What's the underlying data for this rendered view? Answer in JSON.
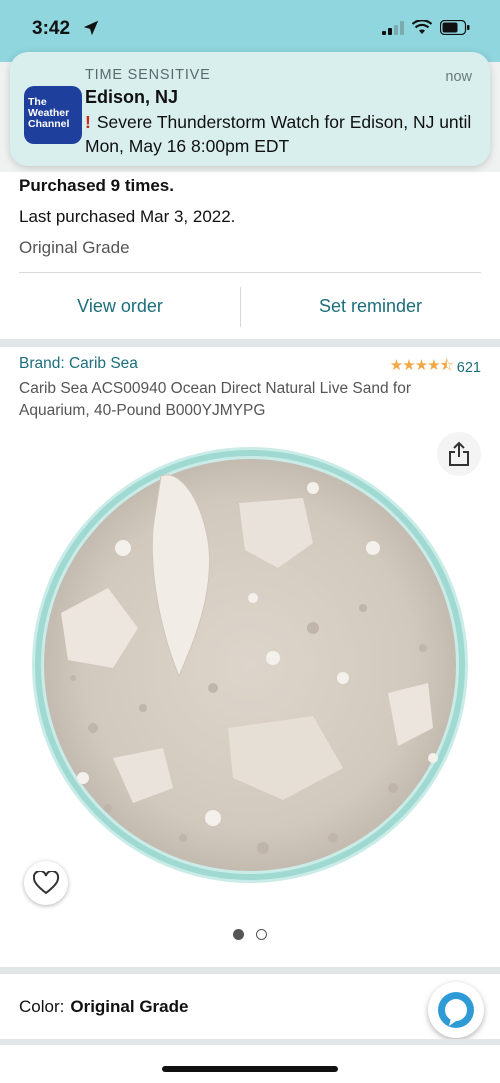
{
  "status_bar": {
    "time": "3:42"
  },
  "notification": {
    "app_logo_text": "The Weather Channel",
    "kicker": "TIME SENSITIVE",
    "time": "now",
    "title": "Edison, NJ",
    "body": "Severe Thunderstorm Watch for Edison, NJ until Mon, May 16 8:00pm EDT",
    "alert_glyph": "!"
  },
  "purchase_info": {
    "purchased": "Purchased 9 times.",
    "last_purchased": "Last purchased Mar 3, 2022.",
    "grade": "Original Grade",
    "view_order_label": "View order",
    "set_reminder_label": "Set reminder"
  },
  "product": {
    "brand": "Brand: Carib Sea",
    "rating_stars": 4.5,
    "rating_count": "621",
    "title": "Carib Sea ACS00940 Ocean Direct Natural Live Sand for Aquarium, 40-Pound B000YJMYPG",
    "image_page": 1,
    "image_count": 2
  },
  "color": {
    "label": "Color:",
    "value": "Original Grade"
  },
  "icons": [
    "location-arrow-icon",
    "signal-icon",
    "wifi-icon",
    "battery-icon",
    "share-icon",
    "heart-icon",
    "alexa-icon"
  ],
  "colors": {
    "link": "#1b6e7a",
    "star": "#f3a847",
    "alert": "#d0261c",
    "status_bg": "#8fd6de",
    "logo_bg": "#1f3f9c"
  }
}
